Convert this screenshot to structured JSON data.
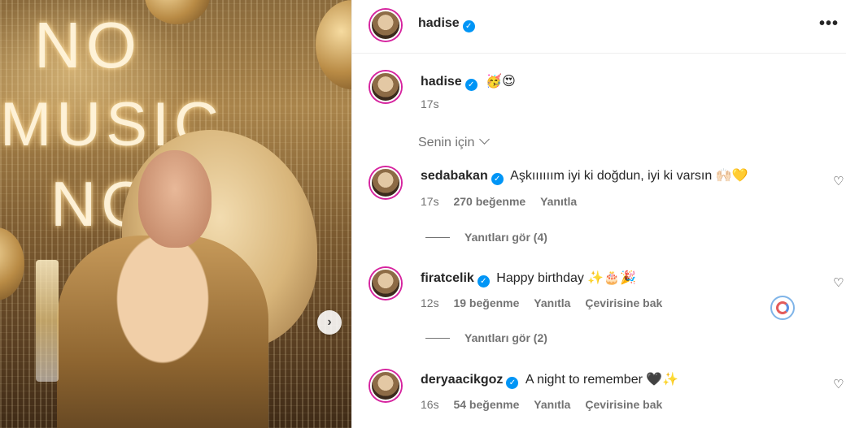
{
  "post": {
    "author": "hadise",
    "caption_emojis": "🥳😍",
    "caption_time": "17s"
  },
  "sort_label": "Senin için",
  "comments": [
    {
      "username": "sedabakan",
      "text": "Aşkıııııım iyi ki doğdun, iyi ki varsın 🙌🏻💛",
      "time": "17s",
      "likes": "270 beğenme",
      "reply": "Yanıtla",
      "translate": "",
      "replies": "Yanıtları gör (4)"
    },
    {
      "username": "firatcelik",
      "text": "Happy birthday ✨🎂🎉",
      "time": "12s",
      "likes": "19 beğenme",
      "reply": "Yanıtla",
      "translate": "Çevirisine bak",
      "replies": "Yanıtları gör (2)"
    },
    {
      "username": "deryaacikgoz",
      "text": "A night to remember 🖤✨",
      "time": "16s",
      "likes": "54 beğenme",
      "reply": "Yanıtla",
      "translate": "Çevirisine bak",
      "replies": ""
    }
  ],
  "photo": {
    "neon_lines": [
      "NO",
      "MUSIC",
      "NO"
    ]
  },
  "icons": {
    "verified": "verified-badge-icon",
    "more": "more-options-icon",
    "like": "heart-icon",
    "next": "chevron-right-icon"
  },
  "colors": {
    "verified": "#0095f6",
    "muted_text": "#737373",
    "text": "#262626"
  }
}
